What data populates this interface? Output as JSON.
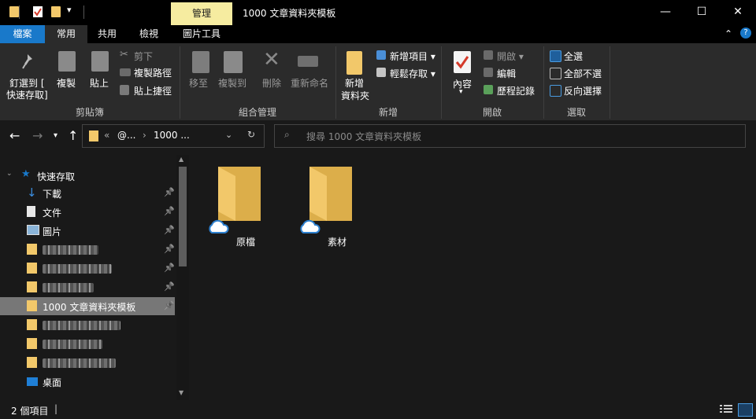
{
  "window": {
    "title": "1000 文章資料夾模板",
    "contextual_tab": "管理",
    "controls": [
      "—",
      "☐",
      "✕"
    ]
  },
  "tabs": [
    {
      "label": "檔案",
      "active_file": true
    },
    {
      "label": "常用",
      "selected": true
    },
    {
      "label": "共用"
    },
    {
      "label": "檢視"
    },
    {
      "label": "圖片工具"
    }
  ],
  "ribbon": {
    "clipboard": {
      "pin_line1": "釘選到 [",
      "pin_line2": "快速存取]",
      "copy": "複製",
      "paste": "貼上",
      "cut": "剪下",
      "copy_path": "複製路徑",
      "paste_shortcut": "貼上捷徑",
      "group": "剪貼簿"
    },
    "organize": {
      "move_to": "移至",
      "copy_to": "複製到",
      "delete": "刪除",
      "rename": "重新命名",
      "group": "組合管理"
    },
    "new": {
      "new_folder_line1": "新增",
      "new_folder_line2": "資料夾",
      "new_item": "新增項目 ▾",
      "easy_access": "輕鬆存取 ▾",
      "group": "新增"
    },
    "open": {
      "properties": "內容",
      "open": "開啟 ▾",
      "edit": "編輯",
      "history": "歷程記錄",
      "group": "開啟"
    },
    "select": {
      "select_all": "全選",
      "select_none": "全部不選",
      "invert": "反向選擇",
      "group": "選取"
    }
  },
  "address": {
    "chevrons": "«",
    "crumb1": "@...",
    "sep": "›",
    "crumb2": "1000 ...",
    "search_placeholder": "搜尋 1000 文章資料夾模板"
  },
  "navpane": {
    "quick_access": "快速存取",
    "items": [
      {
        "label": "下載",
        "icon": "download-icon",
        "pinned": true
      },
      {
        "label": "文件",
        "icon": "document-icon",
        "pinned": true
      },
      {
        "label": "圖片",
        "icon": "picture-icon",
        "pinned": true
      },
      {
        "label": "",
        "icon": "folder-icon",
        "pinned": true,
        "blurred": true
      },
      {
        "label": "",
        "icon": "folder-icon",
        "pinned": true,
        "blurred": true
      },
      {
        "label": "",
        "icon": "folder-icon",
        "pinned": true,
        "blurred": true
      },
      {
        "label": "1000 文章資料夾模板",
        "icon": "folder-icon",
        "pinned": true,
        "selected": true
      },
      {
        "label": "",
        "icon": "folder-icon",
        "blurred": true
      },
      {
        "label": "",
        "icon": "folder-icon",
        "blurred": true
      },
      {
        "label": "",
        "icon": "folder-icon",
        "blurred": true
      },
      {
        "label": "桌面",
        "icon": "desktop-icon"
      }
    ]
  },
  "content": {
    "folders": [
      {
        "name": "原檔",
        "cloud": true
      },
      {
        "name": "素材",
        "cloud": true
      }
    ]
  },
  "status": {
    "count": "2 個項目",
    "cursor": "|"
  },
  "colors": {
    "accent": "#1979ca",
    "folder": "#f2c86a",
    "context_tab": "#f6eca0"
  }
}
